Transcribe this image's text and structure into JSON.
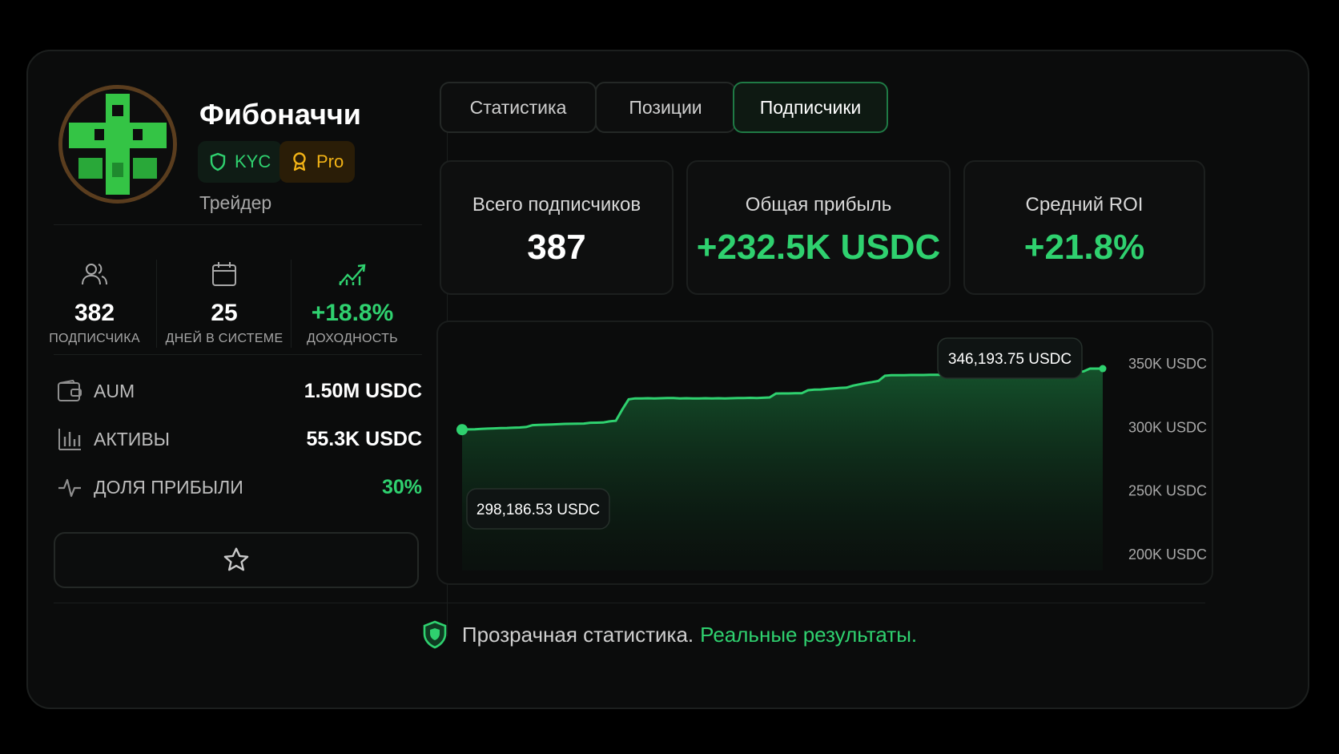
{
  "profile": {
    "name": "Фибоначчи",
    "badges": {
      "kyc": "KYC",
      "pro": "Pro"
    },
    "role": "Трейдер"
  },
  "stats": [
    {
      "value": "382",
      "label": "ПОДПИСЧИКА",
      "icon": "users-icon"
    },
    {
      "value": "25",
      "label": "ДНЕЙ В СИСТЕМЕ",
      "icon": "calendar-icon"
    },
    {
      "value": "+18.8%",
      "label": "ДОХОДНОСТЬ",
      "icon": "trend-chart-icon"
    }
  ],
  "details": [
    {
      "label": "AUM",
      "value": "1.50M USDC",
      "icon": "wallet-icon"
    },
    {
      "label": "АКТИВЫ",
      "value": "55.3K USDC",
      "icon": "bar-chart-icon"
    },
    {
      "label": "ДОЛЯ ПРИБЫЛИ",
      "value": "30%",
      "icon": "pulse-icon"
    }
  ],
  "tabs": [
    {
      "label": "Статистика"
    },
    {
      "label": "Позиции"
    },
    {
      "label": "Подписчики"
    }
  ],
  "kpis": [
    {
      "label": "Всего подписчиков",
      "value": "387"
    },
    {
      "label": "Общая прибыль",
      "value": "+232.5K USDC"
    },
    {
      "label": "Средний ROI",
      "value": "+21.8%"
    }
  ],
  "footer": {
    "text": "Прозрачная статистика.",
    "highlight": "Реальные результаты."
  },
  "colors": {
    "accent": "#2fd16f",
    "pro": "#f2b316",
    "background": "#0b0c0c"
  },
  "chart_data": {
    "type": "area",
    "x": [
      0,
      1,
      2,
      3,
      4,
      5,
      6,
      7,
      8,
      9,
      10,
      11,
      12,
      13,
      14,
      15,
      16,
      17,
      18,
      19,
      20,
      21,
      22,
      23,
      24,
      25,
      26,
      27,
      28,
      29,
      30,
      31,
      32,
      33,
      34,
      35,
      36,
      37,
      38,
      39,
      40,
      41,
      42,
      43,
      44,
      45,
      46,
      47,
      48,
      49,
      50,
      51,
      52,
      53,
      54,
      55,
      56,
      57,
      58,
      59,
      60,
      61,
      62,
      63,
      64,
      65,
      66,
      67,
      68,
      69,
      70,
      71,
      72,
      73,
      74,
      75,
      76,
      77,
      78,
      79,
      80,
      81,
      82,
      83,
      84,
      85,
      86,
      87,
      88,
      89,
      90,
      91,
      92,
      93,
      94,
      95,
      96,
      97,
      98,
      99,
      100
    ],
    "values": [
      298186.53,
      298400,
      298500,
      298800,
      299000,
      299200,
      299400,
      299500,
      299800,
      299900,
      300300,
      301700,
      301900,
      302100,
      302300,
      302500,
      302700,
      302800,
      302900,
      303000,
      303600,
      303700,
      303800,
      304700,
      305200,
      314000,
      322000,
      322800,
      322700,
      322900,
      322800,
      322900,
      323000,
      323100,
      322800,
      322900,
      322700,
      322800,
      322900,
      322800,
      322900,
      322800,
      322900,
      323000,
      323100,
      323200,
      323100,
      323300,
      323500,
      326600,
      326700,
      326700,
      326800,
      326800,
      329200,
      329700,
      329800,
      330200,
      330600,
      331000,
      331200,
      332800,
      333800,
      334800,
      335600,
      336600,
      340600,
      341000,
      341000,
      341000,
      341200,
      341200,
      341200,
      341300,
      341300,
      341300,
      341300,
      341300,
      341300,
      341300,
      341400,
      341300,
      341400,
      341400,
      341400,
      341500,
      341500,
      341500,
      341500,
      341500,
      341600,
      343500,
      343700,
      343800,
      343900,
      344000,
      344000,
      344000,
      346193.75,
      346193.75,
      346193.75
    ],
    "annotations": [
      {
        "label": "298,186.53 USDC",
        "at": "start"
      },
      {
        "label": "346,193.75 USDC",
        "at": "end"
      }
    ],
    "yticks": [
      "350K USDC",
      "300K USDC",
      "250K USDC",
      "200K USDC"
    ],
    "ytick_values": [
      350000,
      300000,
      250000,
      200000
    ],
    "ylim": [
      200000,
      350000
    ],
    "grid": false,
    "title": "",
    "xlabel": "",
    "ylabel": ""
  }
}
